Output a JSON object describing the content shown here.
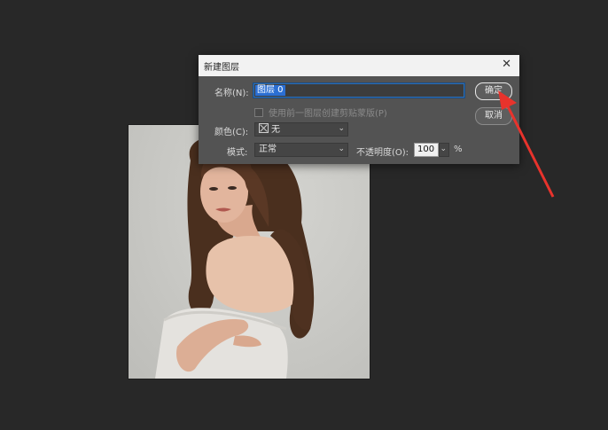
{
  "dialog": {
    "title": "新建图层",
    "close_glyph": "✕",
    "name_label": "名称(N):",
    "name_value": "图层 0",
    "clipping_label": "使用前一图层创建剪贴蒙版(P)",
    "color_label": "颜色(C):",
    "color_value": "无",
    "mode_label": "模式:",
    "mode_value": "正常",
    "opacity_label": "不透明度(O):",
    "opacity_value": "100",
    "opacity_unit": "%",
    "ok_label": "确定",
    "cancel_label": "取消"
  },
  "icons": {
    "chevron": "⌄",
    "close": "close-icon",
    "color_swatch": "no-color-swatch-icon"
  },
  "colors": {
    "workspace": "#282828",
    "dialog_bg": "#535353",
    "selection": "#2b6fd4",
    "annotation_arrow": "#e8332c"
  }
}
